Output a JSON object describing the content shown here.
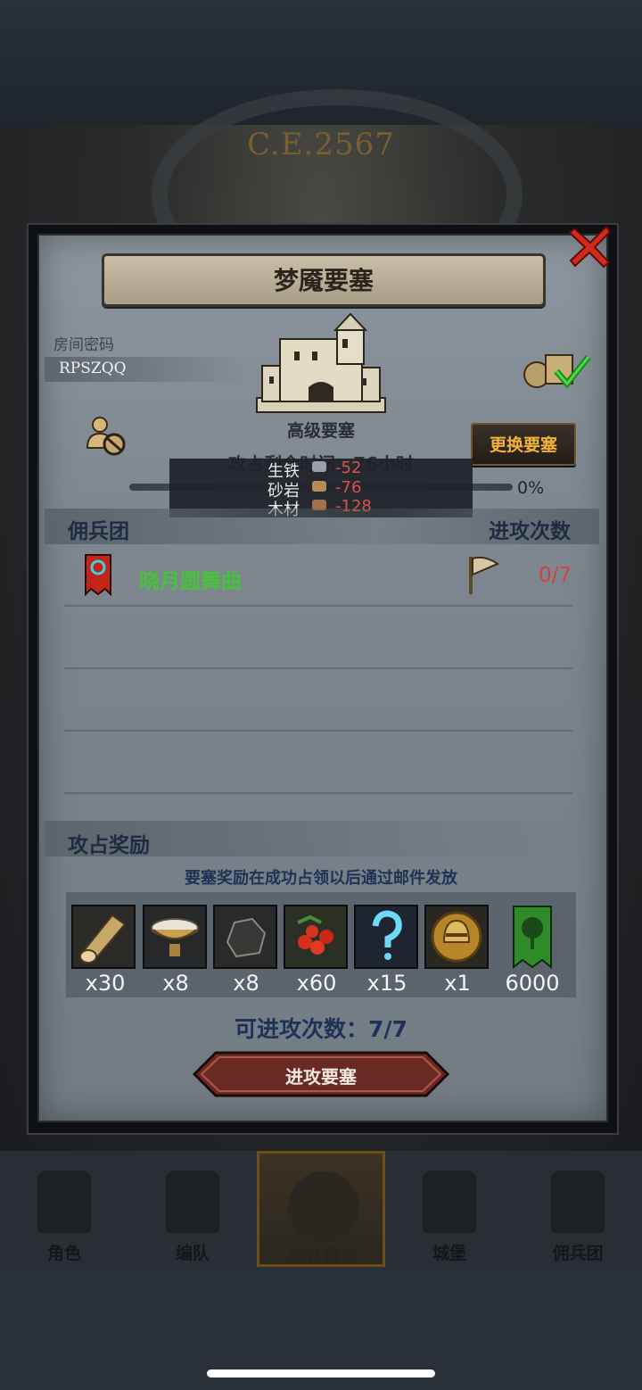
{
  "background": {
    "era": "C.E.2567"
  },
  "dialog": {
    "title": "梦魇要塞",
    "room_code_label": "房间密码",
    "room_code": "RPSZQQ",
    "fortress_level": "高级要塞",
    "change_fortress_label": "更换要塞",
    "remaining_time_text": "攻占剩余时间：76小时",
    "progress_percent": "0%",
    "resources": [
      {
        "name": "生铁",
        "value": "-52",
        "icon": "iron-icon",
        "color": "#9aa0a6"
      },
      {
        "name": "砂岩",
        "value": "-76",
        "icon": "sandstone-icon",
        "color": "#b88a5a"
      },
      {
        "name": "木材",
        "value": "-128",
        "icon": "wood-icon",
        "color": "#a0714a"
      }
    ],
    "mercenary_header": "佣兵团",
    "attack_count_header": "进攻次数",
    "mercenary_rows": [
      {
        "name": "晓月圆舞曲",
        "attacks": "0/7"
      }
    ],
    "reward_header": "攻占奖励",
    "reward_note": "要塞奖励在成功占领以后通过邮件发放",
    "rewards": [
      {
        "icon": "log-icon",
        "count": "x30"
      },
      {
        "icon": "bowl-icon",
        "count": "x8"
      },
      {
        "icon": "ore-icon",
        "count": "x8"
      },
      {
        "icon": "berries-icon",
        "count": "x60"
      },
      {
        "icon": "question-mark-icon",
        "count": "x15"
      },
      {
        "icon": "helmet-medal-icon",
        "count": "x1"
      },
      {
        "icon": "tree-banner-icon",
        "count": "6000"
      }
    ],
    "attempts_text": "可进攻次数：7/7",
    "attack_button_label": "进攻要塞"
  },
  "bottom_nav": [
    {
      "label": "角色",
      "active": false
    },
    {
      "label": "编队",
      "active": false
    },
    {
      "label": "前往群岛",
      "active": true
    },
    {
      "label": "城堡",
      "active": false
    },
    {
      "label": "佣兵团",
      "active": false
    }
  ]
}
